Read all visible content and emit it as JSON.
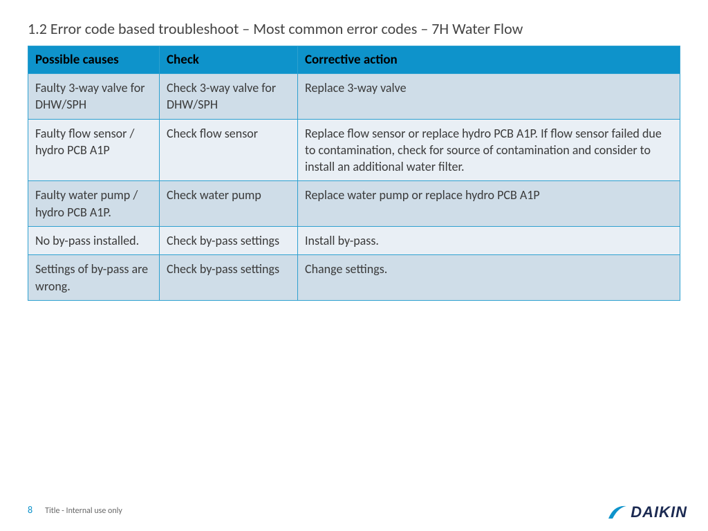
{
  "title": "1.2 Error code based troubleshoot –  Most common error codes – 7H Water Flow",
  "table": {
    "headers": [
      "Possible causes",
      "Check",
      "Corrective action"
    ],
    "rows": [
      {
        "cause": "Faulty 3-way valve for DHW/SPH",
        "check": "Check 3-way valve for DHW/SPH",
        "action": "Replace 3-way valve"
      },
      {
        "cause": "Faulty flow sensor / hydro PCB A1P",
        "check": "Check flow sensor",
        "action": "Replace flow sensor or\nreplace hydro PCB A1P.\nIf flow sensor failed due to contamination, check for source of contamination and consider to install an additional water filter."
      },
      {
        "cause": "Faulty water pump / hydro PCB A1P.",
        "check": "Check water pump",
        "action": "Replace water pump  or\nreplace hydro PCB A1P"
      },
      {
        "cause": "No by-pass installed.",
        "check": "Check by-pass settings",
        "action": "Install by-pass."
      },
      {
        "cause": "Settings of by-pass are wrong.",
        "check": "Check by-pass settings",
        "action": "Change settings."
      }
    ]
  },
  "footer": {
    "page": "8",
    "text": "Title - Internal use only"
  },
  "logo": {
    "text": "DAIKIN"
  }
}
